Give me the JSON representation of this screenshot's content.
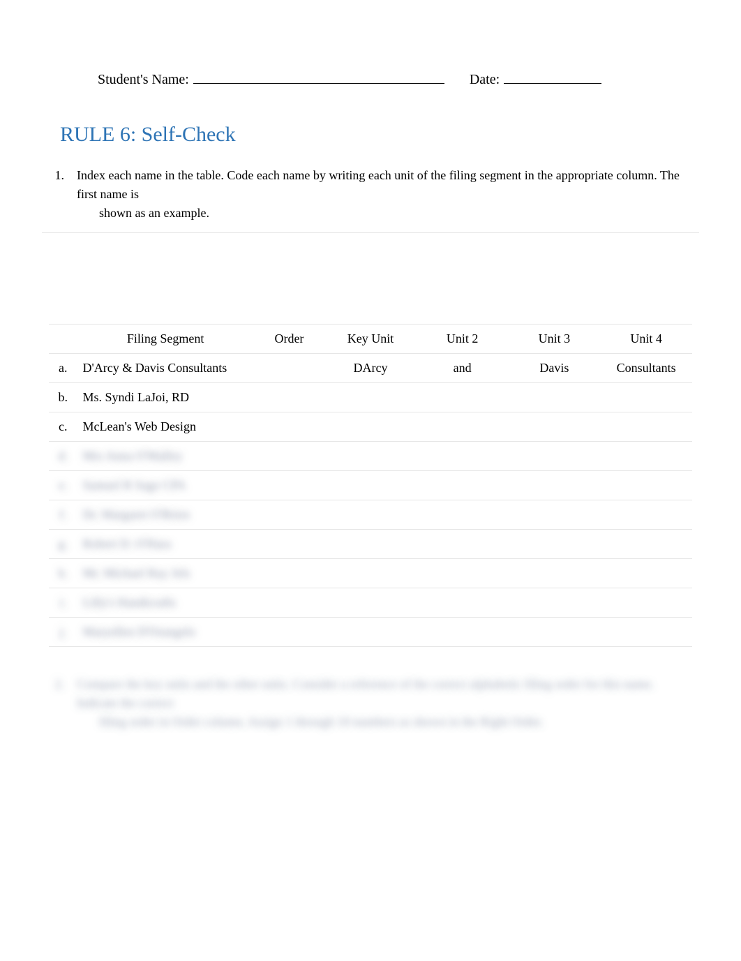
{
  "header": {
    "student_label": "Student's Name:",
    "date_label": "Date:"
  },
  "title": "RULE 6: Self-Check",
  "instruction": {
    "number": "1.",
    "line1": "Index each name in the table. Code each name by writing each unit of the filing segment in the appropriate column. The first name is",
    "line2": "shown as an example."
  },
  "table": {
    "headers": {
      "filing_segment": "Filing Segment",
      "order": "Order",
      "key_unit": "Key Unit",
      "unit2": "Unit 2",
      "unit3": "Unit 3",
      "unit4": "Unit 4"
    },
    "rows": [
      {
        "letter": "a.",
        "segment": "D'Arcy & Davis Consultants",
        "order": "",
        "key_unit": "DArcy",
        "unit2": "and",
        "unit3": "Davis",
        "unit4": "Consultants",
        "blurred": false
      },
      {
        "letter": "b.",
        "segment": "Ms. Syndi LaJoi, RD",
        "order": "",
        "key_unit": "",
        "unit2": "",
        "unit3": "",
        "unit4": "",
        "blurred": false
      },
      {
        "letter": "c.",
        "segment": "McLean's Web Design",
        "order": "",
        "key_unit": "",
        "unit2": "",
        "unit3": "",
        "unit4": "",
        "blurred": false
      },
      {
        "letter": "d.",
        "segment": "Mrs Anna O'Malley",
        "order": "",
        "key_unit": "",
        "unit2": "",
        "unit3": "",
        "unit4": "",
        "blurred": true
      },
      {
        "letter": "e.",
        "segment": "Samuel R Sage CPA",
        "order": "",
        "key_unit": "",
        "unit2": "",
        "unit3": "",
        "unit4": "",
        "blurred": true
      },
      {
        "letter": "f.",
        "segment": "Dr. Margaret O'Brien",
        "order": "",
        "key_unit": "",
        "unit2": "",
        "unit3": "",
        "unit4": "",
        "blurred": true
      },
      {
        "letter": "g.",
        "segment": "Robert D. O'Hara",
        "order": "",
        "key_unit": "",
        "unit2": "",
        "unit3": "",
        "unit4": "",
        "blurred": true
      },
      {
        "letter": "h.",
        "segment": "Mr. Michael Ray Jels",
        "order": "",
        "key_unit": "",
        "unit2": "",
        "unit3": "",
        "unit4": "",
        "blurred": true
      },
      {
        "letter": "i.",
        "segment": "Lilly's Handicrafts",
        "order": "",
        "key_unit": "",
        "unit2": "",
        "unit3": "",
        "unit4": "",
        "blurred": true
      },
      {
        "letter": "j.",
        "segment": "Maryellen D'Orangelo",
        "order": "",
        "key_unit": "",
        "unit2": "",
        "unit3": "",
        "unit4": "",
        "blurred": true
      }
    ]
  },
  "bottom_instruction": {
    "number": "2.",
    "line1": "Compare the key units and the other units. Consider a reference of the correct alphabetic filing order for this name. Indicate the correct",
    "line2": "filing order in Order column. Assign 1 through 10 numbers as shown in the Right Order."
  }
}
